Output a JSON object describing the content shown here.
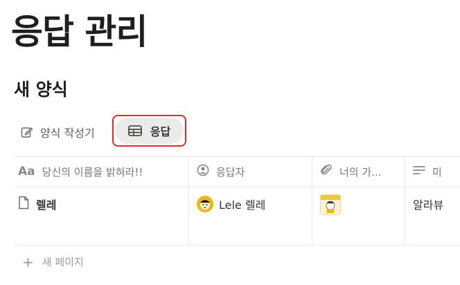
{
  "page": {
    "title": "응답 관리",
    "section_title": "새 양식"
  },
  "view_tabs": {
    "form_builder": "양식 작성기",
    "responses": "응답"
  },
  "table": {
    "columns": [
      {
        "icon": "text-property-icon",
        "icon_text": "Aa",
        "label": "당신의 이름을 밝혀라!!"
      },
      {
        "icon": "person-property-icon",
        "label": "응답자"
      },
      {
        "icon": "link-property-icon",
        "label": "너의 가..."
      },
      {
        "icon": "lines-property-icon",
        "label": "미"
      }
    ],
    "rows": [
      {
        "name": "렐레",
        "respondent": "Lele 렐레",
        "file": "image-thumbnail",
        "text": "알라뷰"
      }
    ]
  },
  "new_page_label": "새 페이지",
  "colors": {
    "highlight_border": "#e8262a",
    "active_tab_bg": "#ebebea",
    "avatar_yellow": "#f2b705"
  }
}
